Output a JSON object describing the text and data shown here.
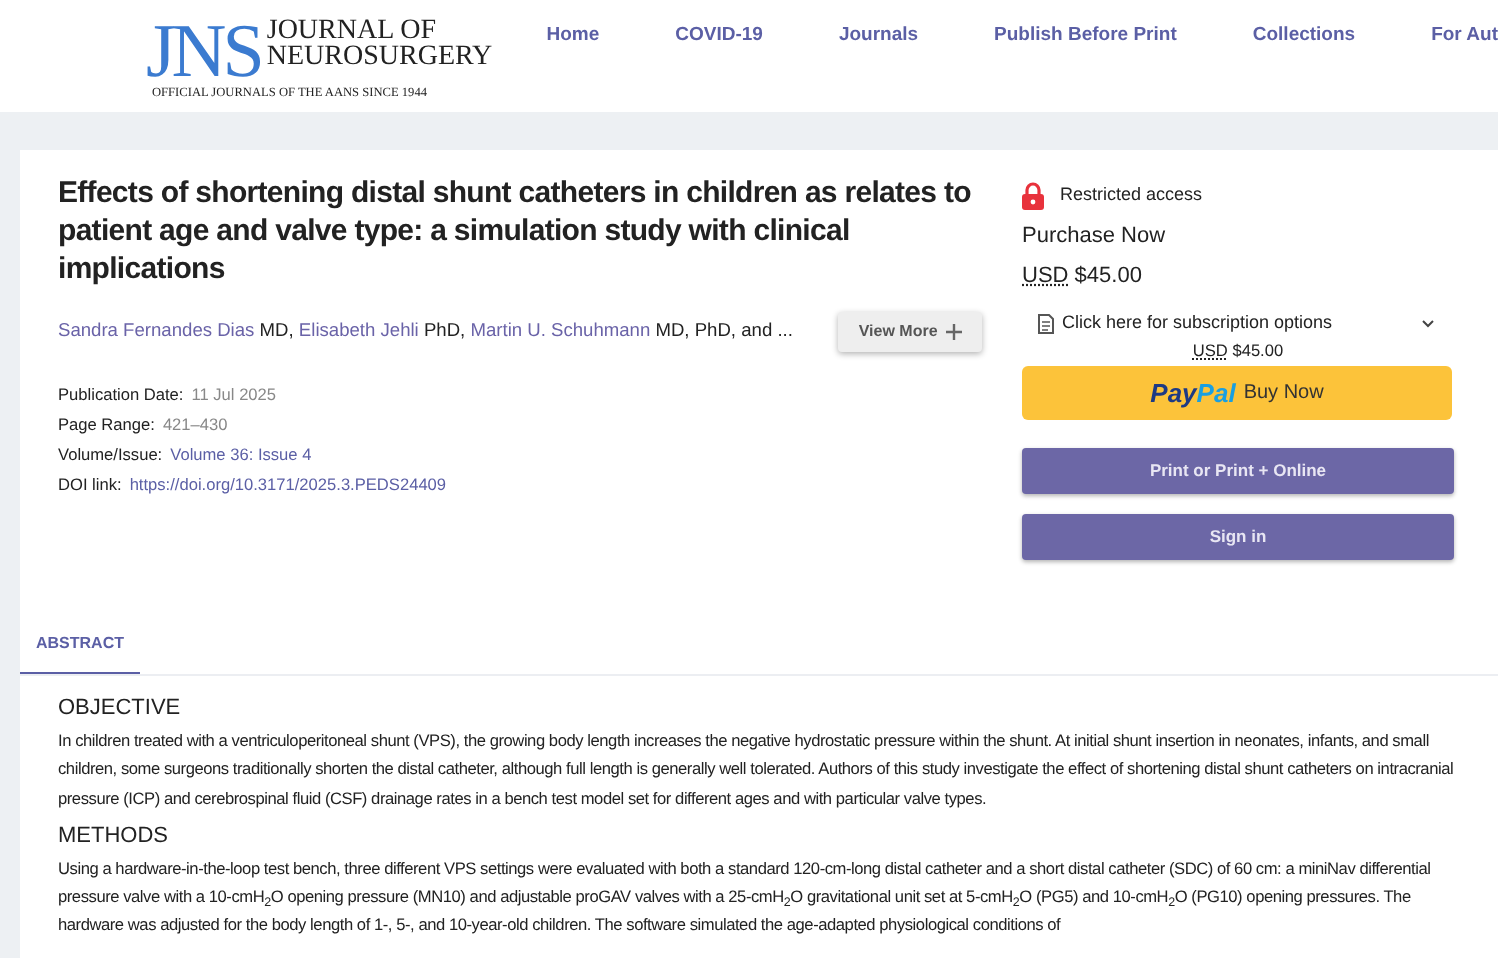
{
  "header": {
    "logo": {
      "mark": "JNS",
      "line1": "JOURNAL OF",
      "line2": "NEUROSURGERY",
      "tagline": "OFFICIAL JOURNALS OF THE AANS SINCE 1944"
    },
    "nav": [
      "Home",
      "COVID-19",
      "Journals",
      "Publish Before Print",
      "Collections",
      "For Aut"
    ]
  },
  "article": {
    "title": "Effects of shortening distal shunt catheters in children as relates to patient age and valve type: a simulation study with clinical implications",
    "authors": [
      {
        "name": "Sandra Fernandes Dias",
        "degrees": "MD,"
      },
      {
        "name": "Elisabeth Jehli",
        "degrees": "PhD,"
      },
      {
        "name": "Martin U. Schuhmann",
        "degrees": "MD, PhD,"
      }
    ],
    "authors_more": "and ...",
    "view_more": "View More",
    "meta": [
      {
        "label": "Publication Date:",
        "value": "11 Jul 2025",
        "kind": "plain"
      },
      {
        "label": "Page Range:",
        "value": "421–430",
        "kind": "plain"
      },
      {
        "label": "Volume/Issue:",
        "value": "Volume 36: Issue 4",
        "kind": "link"
      },
      {
        "label": "DOI link:",
        "value": "https://doi.org/10.3171/2025.3.PEDS24409",
        "kind": "link"
      }
    ]
  },
  "purchase": {
    "access": "Restricted access",
    "heading": "Purchase Now",
    "currency": "USD",
    "price": "$45.00",
    "subscription": "Click here for subscription options",
    "sub_currency": "USD",
    "sub_price": "$45.00",
    "paypal": {
      "brand_a": "Pay",
      "brand_b": "Pal",
      "label": "Buy Now"
    },
    "buttons": [
      "Print or Print + Online",
      "Sign in"
    ]
  },
  "tabs": [
    {
      "label": "ABSTRACT",
      "selected": true
    }
  ],
  "abstract": [
    {
      "heading": "OBJECTIVE",
      "text": "In children treated with a ventriculoperitoneal shunt (VPS), the growing body length increases the negative hydrostatic pressure within the shunt. At initial shunt insertion in neonates, infants, and small children, some surgeons traditionally shorten the distal catheter, although full length is generally well tolerated. Authors of this study investigate the effect of shortening distal shunt catheters on intracranial pressure (ICP) and cerebrospinal fluid (CSF) drainage rates in a bench test model set for different ages and with particular valve types."
    },
    {
      "heading": "METHODS",
      "text": "Using a hardware-in-the-loop test bench, three different VPS settings were evaluated with both a standard 120-cm-long distal catheter and a short distal catheter (SDC) of 60 cm: a miniNav differential pressure valve with a 10-cmH$_{2}$O opening pressure (MN10) and adjustable proGAV valves with a 25-cmH$_{2}$O gravitational unit set at 5-cmH$_{2}$O (PG5) and 10-cmH$_{2}$O (PG10) opening pressures. The hardware was adjusted for the body length of 1-, 5-, and 10-year-old children. The software simulated the age-adapted physiological conditions of"
    }
  ]
}
